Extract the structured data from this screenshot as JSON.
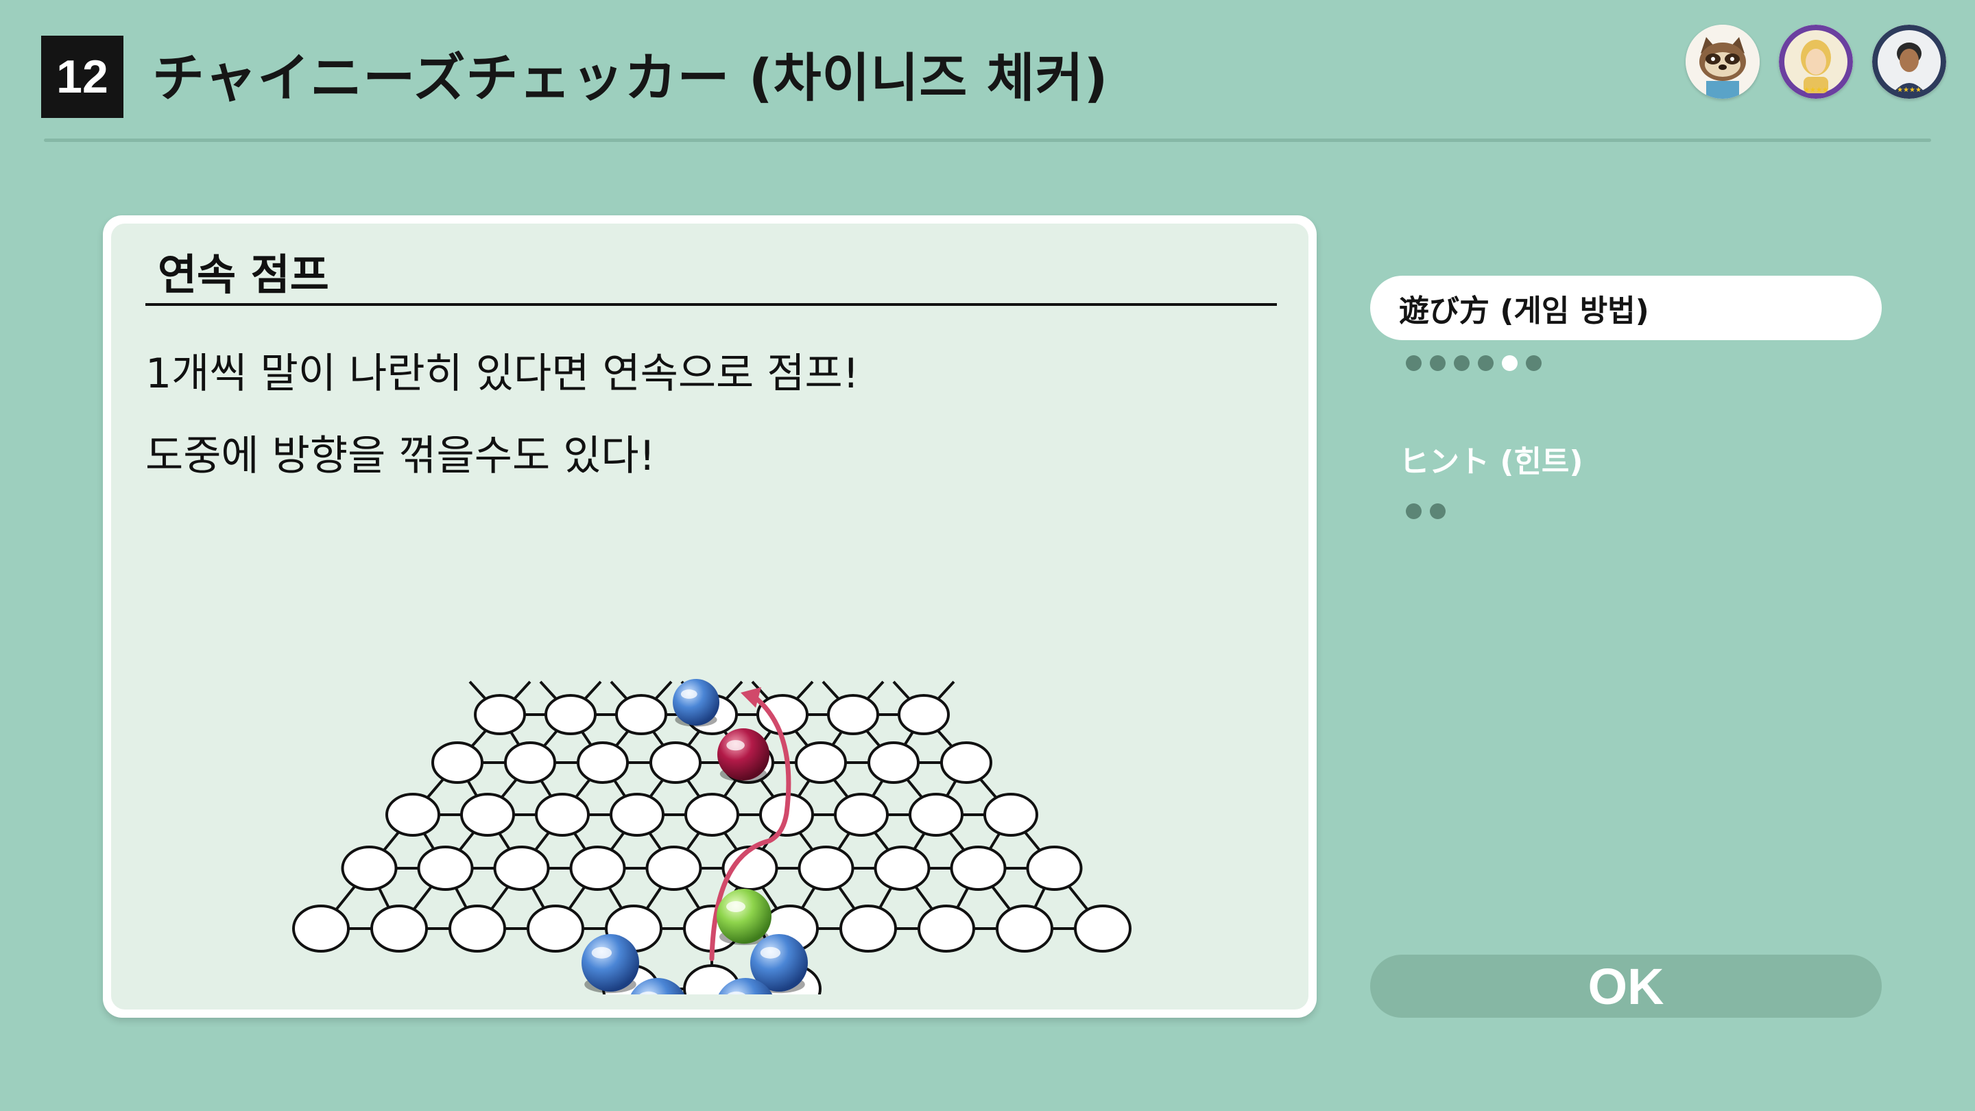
{
  "header": {
    "number": "12",
    "title": "チャイニーズチェッカー (차이니즈 체커)"
  },
  "players": [
    {
      "name": "raccoon-character"
    },
    {
      "name": "blonde-mii"
    },
    {
      "name": "dark-mii"
    }
  ],
  "card": {
    "heading": "연속 점프",
    "lines": [
      "1개씩 말이 나란히 있다면 연속으로 점프!",
      "도중에 방향을 꺾을수도 있다!"
    ]
  },
  "menu": {
    "items": [
      {
        "label": "遊び方 (게임 방법)",
        "active": true,
        "pages": 6,
        "current_page": 5
      },
      {
        "label": "ヒント (힌트)",
        "active": false,
        "pages": 2,
        "current_page": 0
      }
    ]
  },
  "ok_button": {
    "label": "OK"
  },
  "colors": {
    "background": "#9dcfbe",
    "card": "#e3f0e7",
    "blue_piece": "#3a74c8",
    "red_piece": "#a3123c",
    "green_piece": "#7ec83c",
    "arrow": "#d1496a"
  }
}
